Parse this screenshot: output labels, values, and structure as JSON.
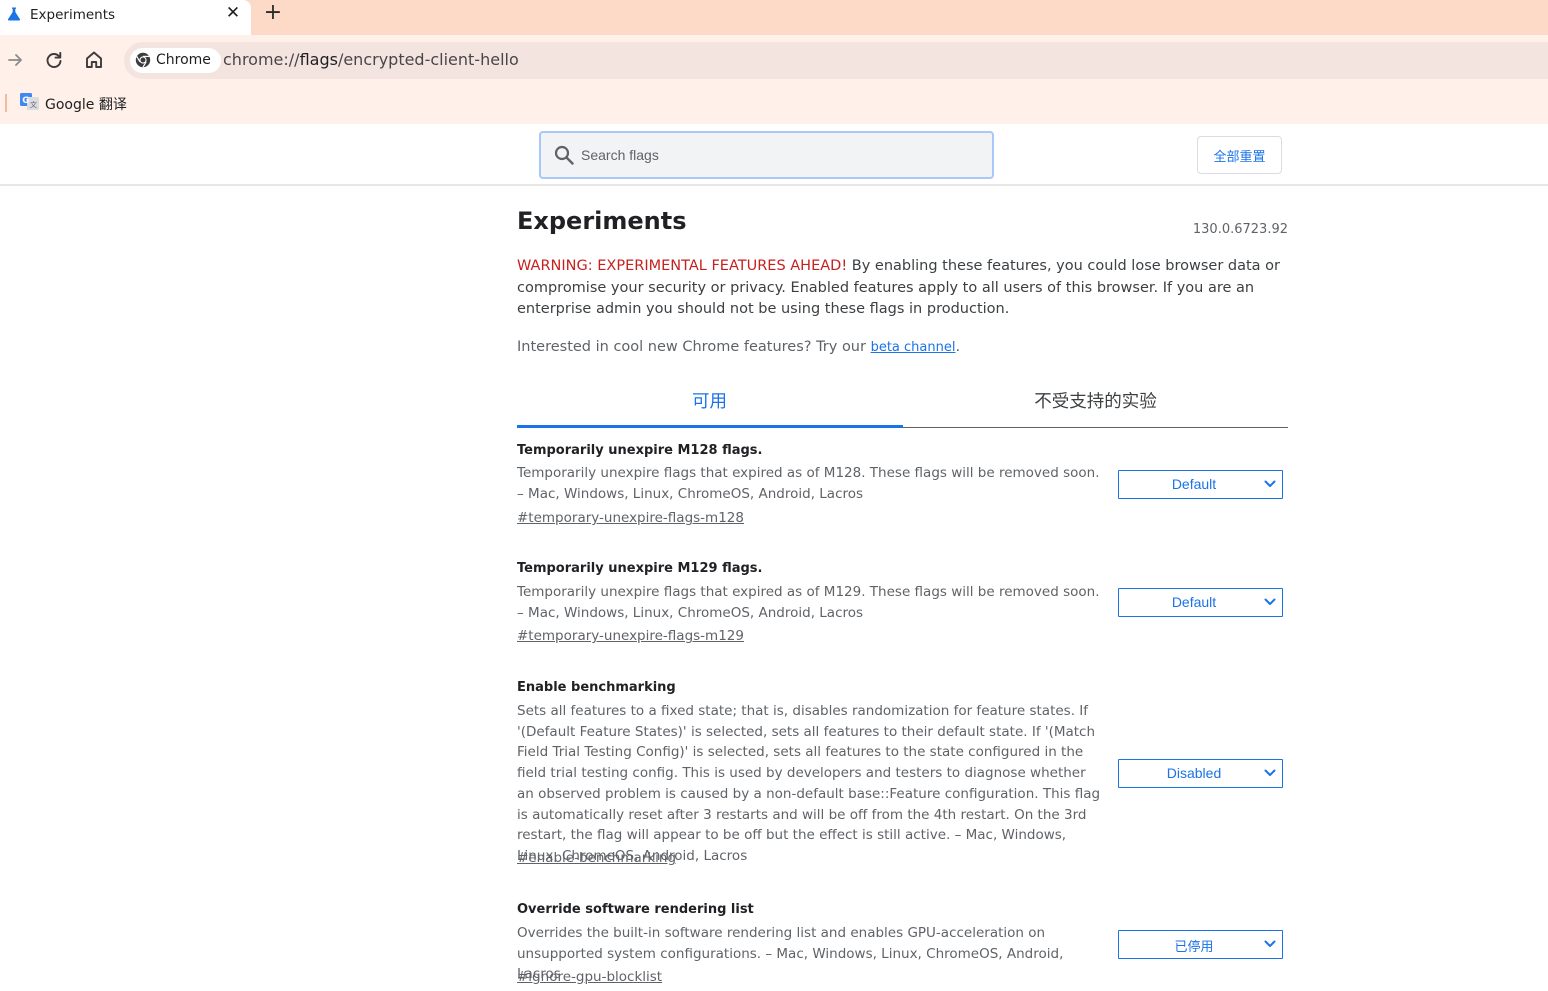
{
  "browser": {
    "tab_title": "Experiments",
    "close_glyph": "✕",
    "new_tab_glyph": "+",
    "security_chip": "Chrome",
    "url_scheme": "chrome://",
    "url_host": "flags",
    "url_path": "/encrypted-client-hello",
    "bookmark_label": "Google 翻译"
  },
  "header": {
    "search_placeholder": "Search flags",
    "reset_label": "全部重置"
  },
  "page": {
    "title": "Experiments",
    "version": "130.0.6723.92",
    "warning_red": "WARNING: EXPERIMENTAL FEATURES AHEAD!",
    "warning_text": " By enabling these features, you could lose browser data or compromise your security or privacy. Enabled features apply to all users of this browser. If you are an enterprise admin you should not be using these flags in production.",
    "beta_prefix": "Interested in cool new Chrome features? Try our ",
    "beta_link": "beta channel",
    "beta_suffix": "."
  },
  "tabs": {
    "available": "可用",
    "unavailable": "不受支持的实验"
  },
  "flags": [
    {
      "name": "Temporarily unexpire M128 flags.",
      "desc": "Temporarily unexpire flags that expired as of M128. These flags will be removed soon. – Mac, Windows, Linux, ChromeOS, Android, Lacros",
      "link": "#temporary-unexpire-flags-m128",
      "value": "Default"
    },
    {
      "name": "Temporarily unexpire M129 flags.",
      "desc": "Temporarily unexpire flags that expired as of M129. These flags will be removed soon. – Mac, Windows, Linux, ChromeOS, Android, Lacros",
      "link": "#temporary-unexpire-flags-m129",
      "value": "Default"
    },
    {
      "name": "Enable benchmarking",
      "desc": "Sets all features to a fixed state; that is, disables randomization for feature states. If '(Default Feature States)' is selected, sets all features to their default state. If '(Match Field Trial Testing Config)' is selected, sets all features to the state configured in the field trial testing config. This is used by developers and testers to diagnose whether an observed problem is caused by a non-default base::Feature configuration. This flag is automatically reset after 3 restarts and will be off from the 4th restart. On the 3rd restart, the flag will appear to be off but the effect is still active. – Mac, Windows, Linux, ChromeOS, Android, Lacros",
      "link": "#enable-benchmarking",
      "value": "Disabled"
    },
    {
      "name": "Override software rendering list",
      "desc": "Overrides the built-in software rendering list and enables GPU-acceleration on unsupported system configurations. – Mac, Windows, Linux, ChromeOS, Android, Lacros",
      "link": "#ignore-gpu-blocklist",
      "value": "已停用"
    }
  ],
  "colors": {
    "accent": "#1a73e8",
    "warning": "#c5221f",
    "tabstrip": "#fdd9c8",
    "toolbar": "#fff0ea"
  },
  "icons": [
    "flask-icon",
    "close-icon",
    "plus-icon",
    "forward-icon",
    "reload-icon",
    "home-icon",
    "chrome-icon",
    "google-translate-icon",
    "search-icon",
    "chevron-down-icon"
  ]
}
